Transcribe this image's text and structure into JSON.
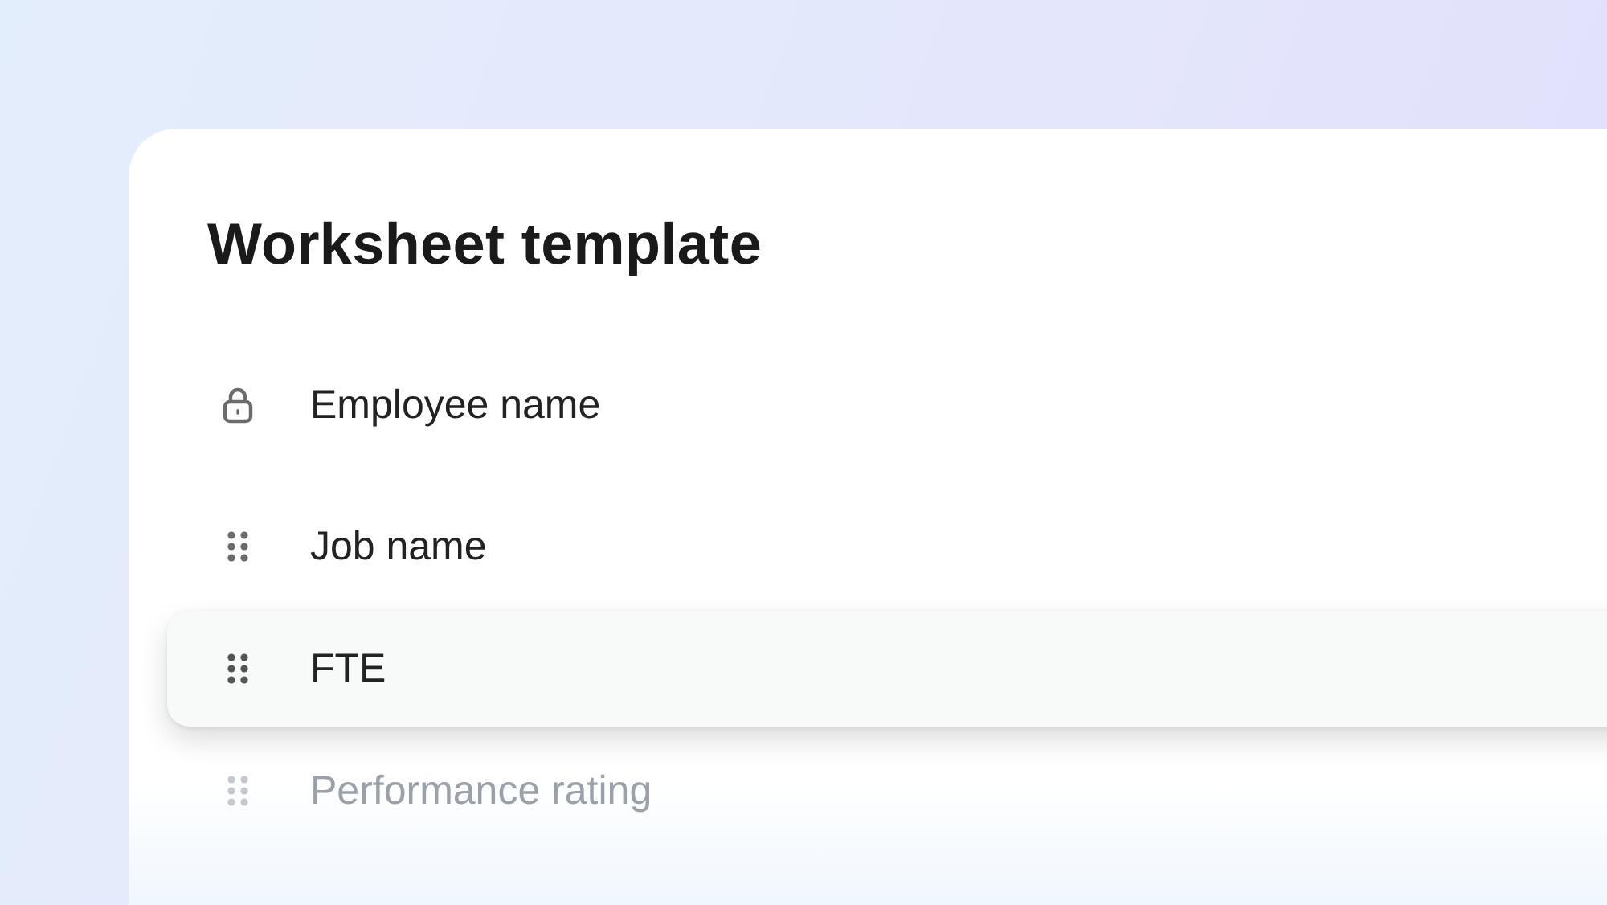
{
  "title": "Worksheet template",
  "fields": [
    {
      "label": "Employee name",
      "kind": "locked",
      "dragging": false,
      "dimmed": false
    },
    {
      "label": "Job name",
      "kind": "draggable",
      "dragging": false,
      "dimmed": false
    },
    {
      "label": "FTE",
      "kind": "draggable",
      "dragging": true,
      "dimmed": false
    },
    {
      "label": "Performance rating",
      "kind": "draggable",
      "dragging": false,
      "dimmed": true
    }
  ]
}
